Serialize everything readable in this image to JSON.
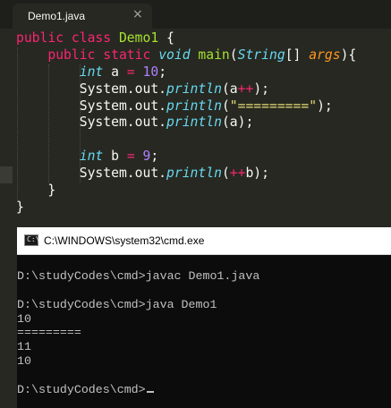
{
  "editor": {
    "tab": {
      "title": "Demo1.java",
      "close_icon": "×"
    },
    "code": {
      "l1": {
        "kw1": "public",
        "kw2": "class",
        "name": "Demo1",
        "brace": " {"
      },
      "l2": {
        "kw1": "public",
        "kw2": "static",
        "type": "void",
        "name": "main",
        "open": "(",
        "ptype": "String",
        "brackets": "[] ",
        "param": "args",
        "close": "){"
      },
      "l3": {
        "type": "int",
        "decl": " a ",
        "eq": "=",
        "sp": " ",
        "num": "10",
        "end": ";"
      },
      "l4": {
        "pre": "System.out.",
        "fn": "println",
        "open": "(a",
        "op": "++",
        "close": ");"
      },
      "l5": {
        "pre": "System.out.",
        "fn": "println",
        "open": "(",
        "str": "\"=========\"",
        "close": ");"
      },
      "l6": {
        "pre": "System.out.",
        "fn": "println",
        "rest": "(a);"
      },
      "l8": {
        "type": "int",
        "decl": " b ",
        "eq": "=",
        "sp": " ",
        "num": "9",
        "end": ";"
      },
      "l9": {
        "pre": "System.out.",
        "fn": "println",
        "open": "(",
        "op": "++",
        "close": "b);"
      },
      "l10": {
        "text": "}"
      },
      "l11": {
        "text": "}"
      }
    }
  },
  "cmd": {
    "title": "C:\\WINDOWS\\system32\\cmd.exe",
    "icon_label": "C:\\",
    "lines": [
      "",
      "D:\\studyCodes\\cmd>javac Demo1.java",
      "",
      "D:\\studyCodes\\cmd>java Demo1",
      "10",
      "=========",
      "11",
      "10",
      "",
      "D:\\studyCodes\\cmd>"
    ]
  }
}
